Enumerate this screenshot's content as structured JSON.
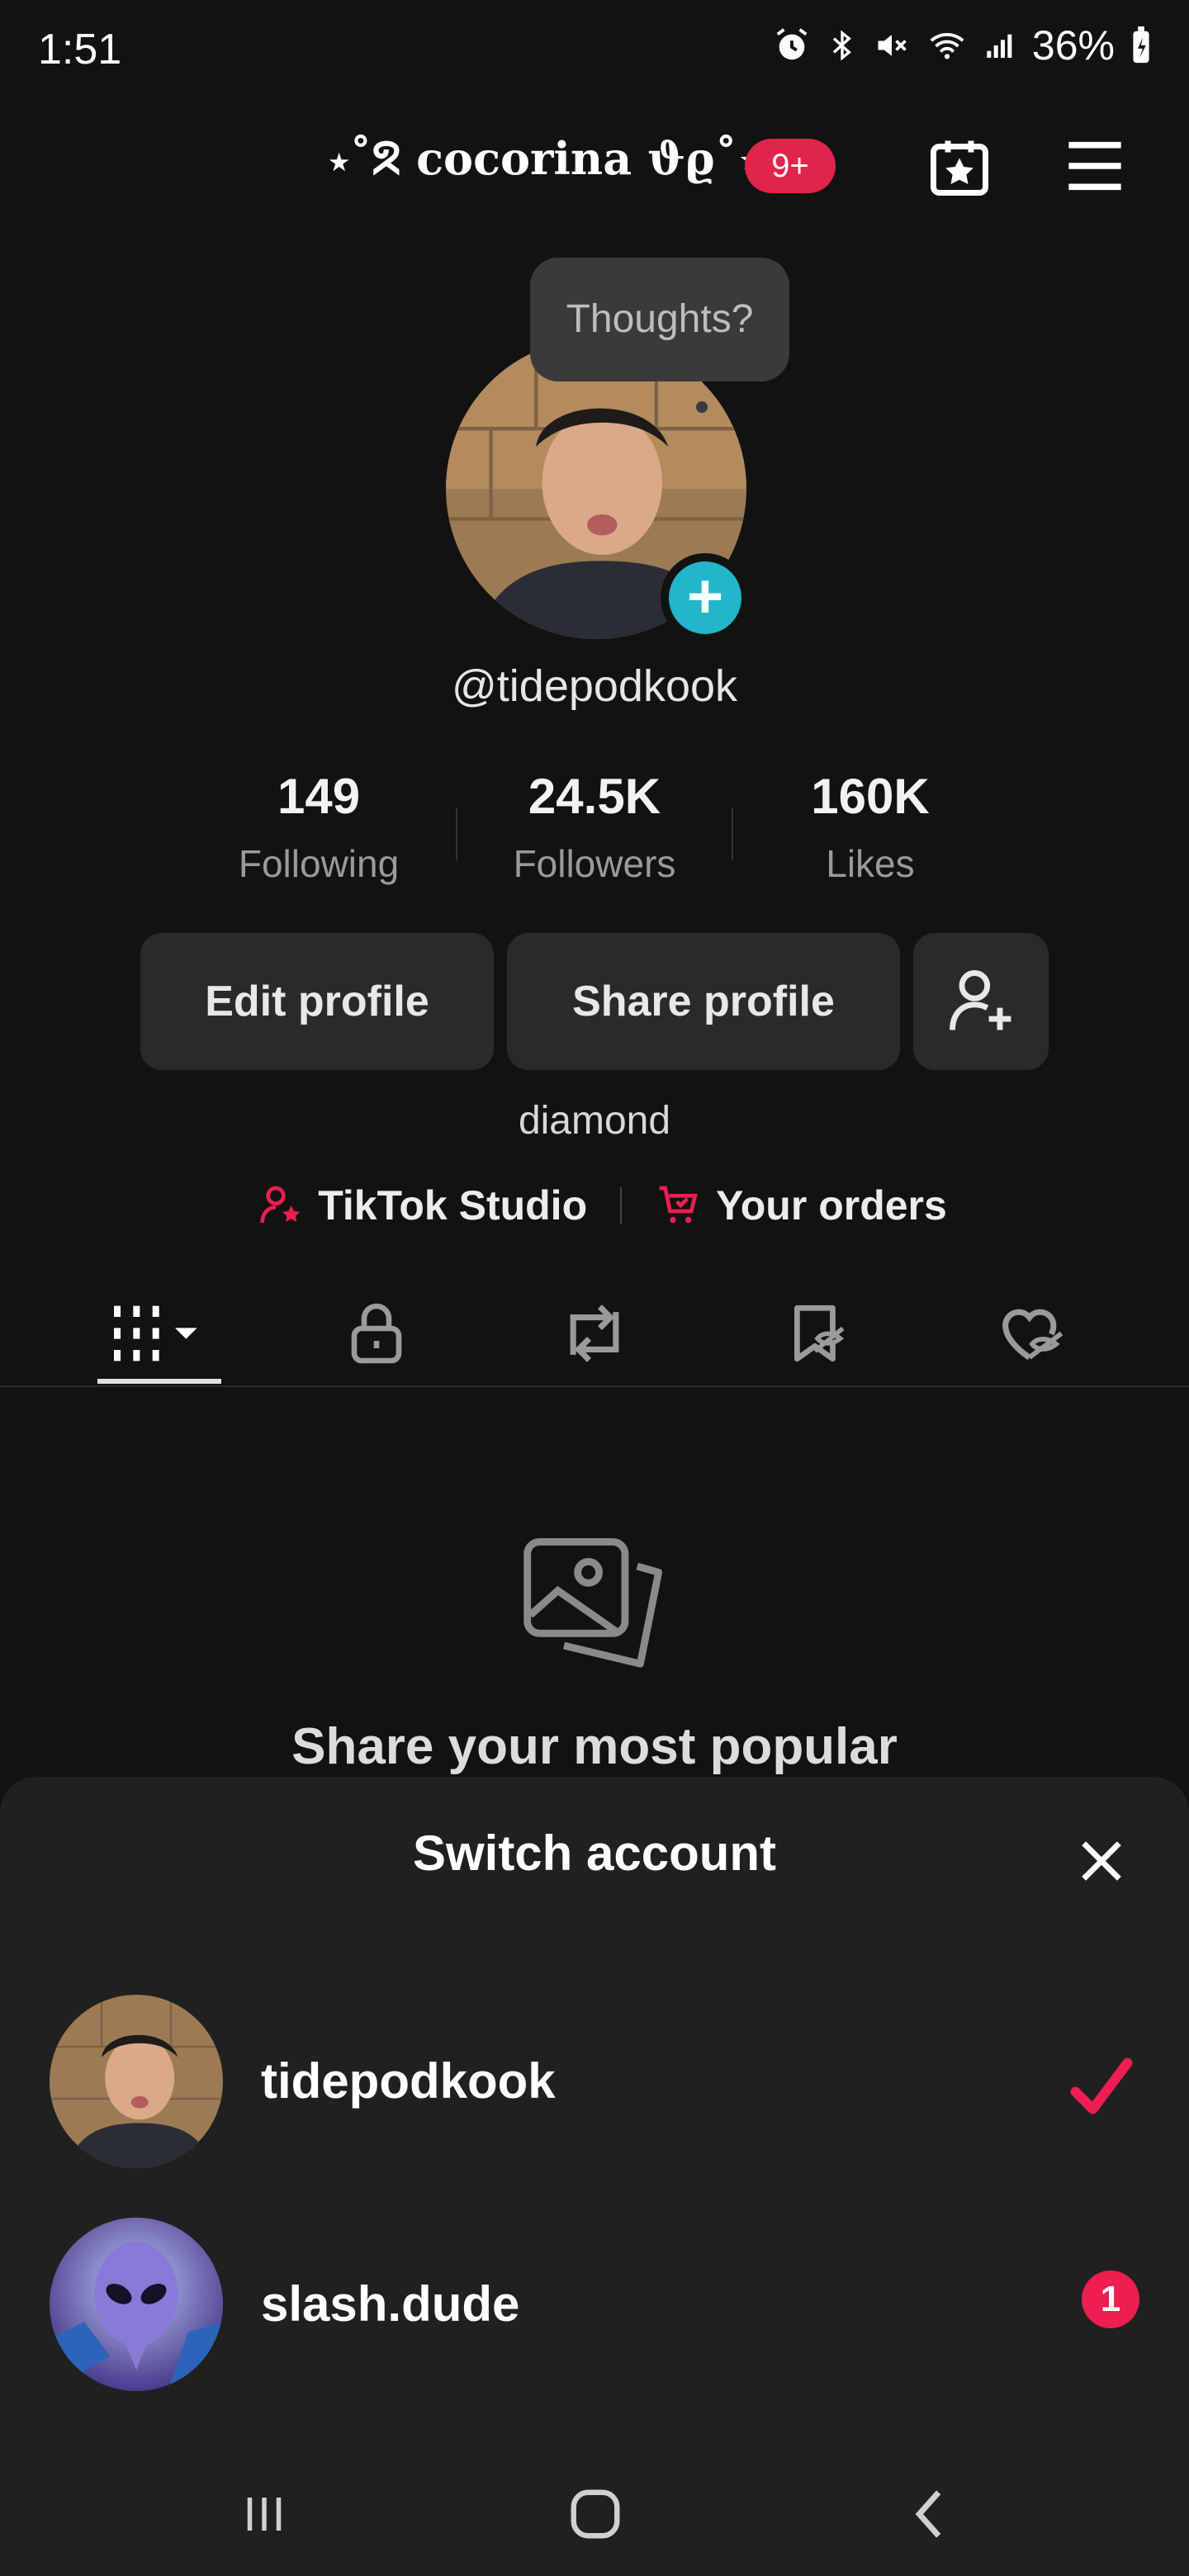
{
  "status_bar": {
    "time": "1:51",
    "battery": "36%"
  },
  "header": {
    "display_name": "⋆˚ᘝ cocorina ϑϱ˚⋆",
    "notification_badge": "9+"
  },
  "profile": {
    "tooltip": "Thoughts?",
    "handle": "@tidepodkook",
    "stats": [
      {
        "value": "149",
        "label": "Following"
      },
      {
        "value": "24.5K",
        "label": "Followers"
      },
      {
        "value": "160K",
        "label": "Likes"
      }
    ],
    "buttons": {
      "edit": "Edit profile",
      "share": "Share profile"
    },
    "bio": "diamond",
    "links": {
      "studio": "TikTok Studio",
      "orders": "Your orders"
    }
  },
  "content": {
    "empty_title": "Share your most popular"
  },
  "switch_sheet": {
    "title": "Switch account",
    "accounts": [
      {
        "name": "tidepodkook",
        "selected": true
      },
      {
        "name": "slash.dude",
        "notifications": "1"
      }
    ]
  },
  "colors": {
    "accent_red": "#ee1d52",
    "teal": "#21b6c9",
    "bg": "#121212",
    "sheet": "#202020"
  }
}
